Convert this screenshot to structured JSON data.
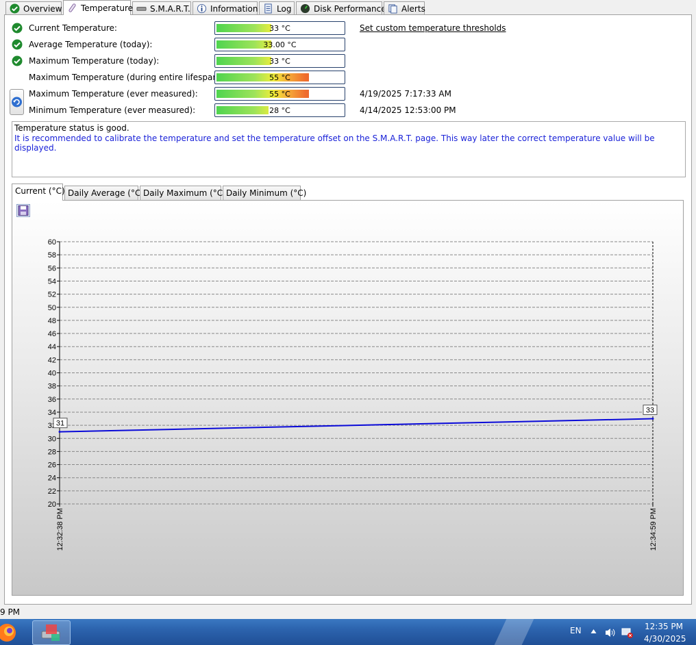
{
  "tabs": [
    {
      "label": "Overview",
      "icon": "check-icon"
    },
    {
      "label": "Temperature",
      "icon": "thermometer-icon"
    },
    {
      "label": "S.M.A.R.T.",
      "icon": "drive-icon"
    },
    {
      "label": "Information",
      "icon": "info-icon"
    },
    {
      "label": "Log",
      "icon": "document-icon"
    },
    {
      "label": "Disk Performance",
      "icon": "gauge-icon"
    },
    {
      "label": "Alerts",
      "icon": "alerts-icon"
    }
  ],
  "temperatures": [
    {
      "label": "Current Temperature:",
      "value": "33 °C",
      "level": 0.43,
      "status_icon": true
    },
    {
      "label": "Average Temperature (today):",
      "value": "33.00 °C",
      "level": 0.43,
      "status_icon": true
    },
    {
      "label": "Maximum Temperature (today):",
      "value": "33 °C",
      "level": 0.43,
      "status_icon": true
    },
    {
      "label": "Maximum Temperature (during entire lifespan):",
      "value": "55 °C",
      "level": 0.73,
      "status_icon": false
    },
    {
      "label": "Maximum Temperature (ever measured):",
      "value": "55 °C",
      "level": 0.73,
      "status_icon": false,
      "date": "4/19/2025 7:17:33 AM"
    },
    {
      "label": "Minimum Temperature (ever measured):",
      "value": "28 °C",
      "level": 0.41,
      "status_icon": false,
      "date": "4/14/2025 12:53:00 PM"
    }
  ],
  "threshold_link": "Set custom temperature thresholds",
  "message": {
    "line1": "Temperature status is good.",
    "line2": "It is recommended to calibrate the temperature and set the temperature offset on the S.M.A.R.T. page. This way later the correct temperature value will be displayed."
  },
  "chart_tabs": [
    "Current (°C)",
    "Daily Average (°C)",
    "Daily Maximum (°C)",
    "Daily Minimum (°C)"
  ],
  "chart_data": {
    "type": "line",
    "x": [
      "12:32:38 PM",
      "12:34:59 PM"
    ],
    "series": [
      {
        "values": [
          31,
          33
        ],
        "color": "#0a0ad8"
      }
    ],
    "point_labels": [
      "31",
      "33"
    ],
    "ylim": [
      20,
      60
    ],
    "yticks": [
      20,
      22,
      24,
      26,
      28,
      30,
      32,
      34,
      36,
      38,
      40,
      42,
      44,
      46,
      48,
      50,
      52,
      54,
      56,
      58,
      60
    ],
    "grid": true
  },
  "statusbar": {
    "text": "9 PM"
  },
  "taskbar": {
    "language": "EN",
    "time": "12:35 PM",
    "date": "4/30/2025"
  }
}
